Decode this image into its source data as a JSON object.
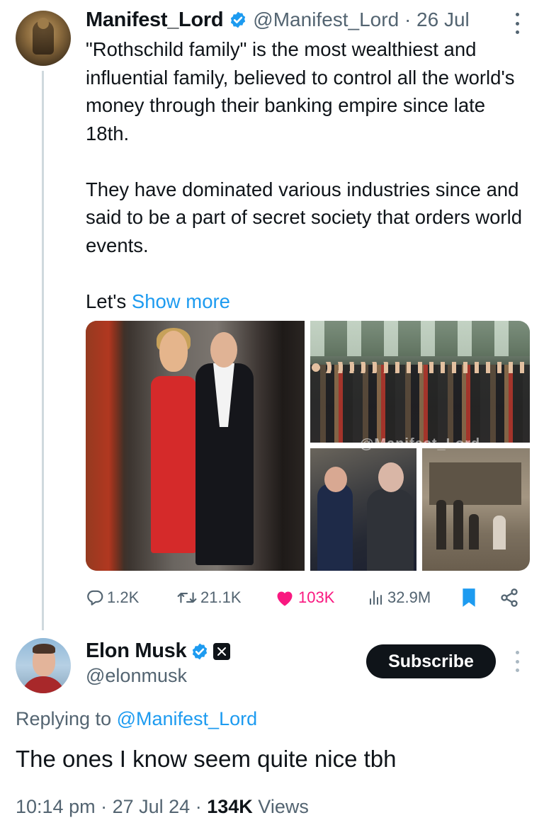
{
  "tweet": {
    "author_name": "Manifest_Lord",
    "handle": "@Manifest_Lord",
    "separator": "·",
    "date": "26 Jul",
    "paragraph1": "\"Rothschild family\" is the most wealthiest and influential family, believed to control all the world's money through their banking empire since late 18th.",
    "paragraph2": "They have dominated various industries since and said to be a part of secret society that orders world events.",
    "paragraph3_prefix": "Let's",
    "show_more": "Show more",
    "watermark": "@Manifest_Lord",
    "stats": {
      "replies": "1.2K",
      "retweets": "21.1K",
      "likes": "103K",
      "views": "32.9M"
    }
  },
  "reply": {
    "author_name": "Elon Musk",
    "handle": "@elonmusk",
    "subscribe_label": "Subscribe",
    "replying_to_prefix": "Replying to",
    "replying_to_handle": "@Manifest_Lord",
    "text": "The ones I know seem quite nice tbh",
    "time": "10:14 pm",
    "date": "27 Jul 24",
    "views_count": "134K",
    "views_label": "Views",
    "separator": "·"
  },
  "colors": {
    "accent_blue": "#1d9bf0",
    "like_pink": "#f91880",
    "secondary_text": "#536471",
    "primary_text": "#0f1419"
  },
  "icons": [
    "verified-badge-icon",
    "more-options-icon",
    "reply-icon",
    "retweet-icon",
    "heart-icon",
    "views-icon",
    "bookmark-icon",
    "share-icon",
    "x-premium-badge-icon"
  ]
}
